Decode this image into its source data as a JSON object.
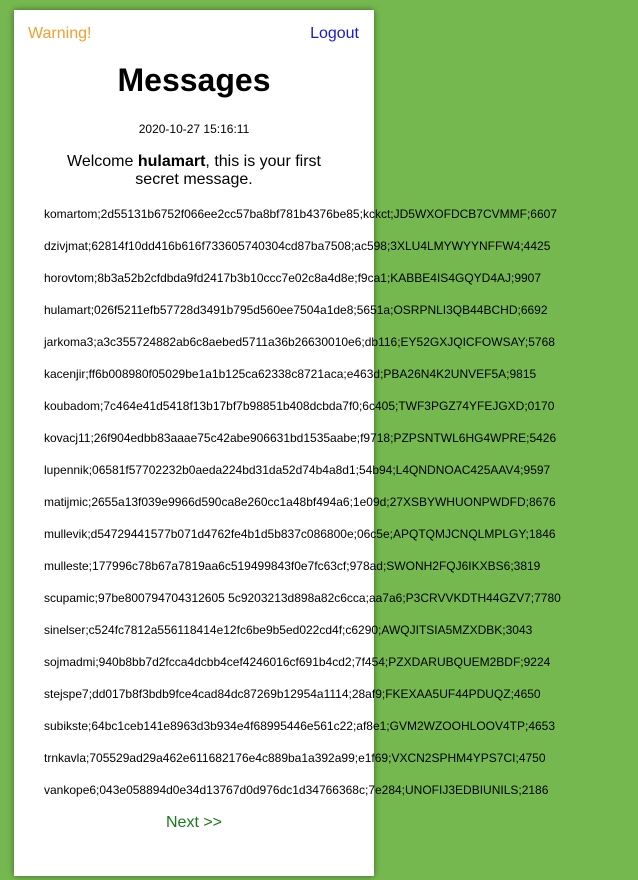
{
  "header": {
    "warning_label": "Warning!",
    "logout_label": "Logout"
  },
  "page": {
    "title": "Messages",
    "timestamp": "2020-10-27 15:16:11"
  },
  "welcome": {
    "prefix": "Welcome ",
    "username": "hulamart",
    "suffix": ", this is your first secret message."
  },
  "messages": [
    "komartom;2d55131b6752f066ee2cc57ba8bf781b4376be85;kckct;JD5WXOFDCB7CVMMF;6607",
    "dzivjmat;62814f10dd416b616f733605740304cd87ba7508;ac598;3XLU4LMYWYYNFFW4;4425",
    "horovtom;8b3a52b2cfdbda9fd2417b3b10ccc7e02c8a4d8e;f9ca1;KABBE4IS4GQYD4AJ;9907",
    "hulamart;026f5211efb57728d3491b795d560ee7504a1de8;5651a;OSRPNLI3QB44BCHD;6692",
    "jarkoma3;a3c355724882ab6c8aebed5711a36b26630010e6;db116;EY52GXJQICFOWSAY;5768",
    "kacenjir;ff6b008980f05029be1a1b125ca62338c8721aca;e463d;PBA26N4K2UNVEF5A;9815",
    "koubadom;7c464e41d5418f13b17bf7b98851b408dcbda7f0;6c405;TWF3PGZ74YFEJGXD;0170",
    "kovacj11;26f904edbb83aaae75c42abe906631bd1535aabe;f9718;PZPSNTWL6HG4WPRE;5426",
    "lupennik;06581f57702232b0aeda224bd31da52d74b4a8d1;54b94;L4QNDNOAC425AAV4;9597",
    "matijmic;2655a13f039e9966d590ca8e260cc1a48bf494a6;1e09d;27XSBYWHUONPWDFD;8676",
    "mullevik;d54729441577b071d4762fe4b1d5b837c086800e;06c5e;APQTQMJCNQLMPLGY;1846",
    "mulleste;177996c78b67a7819aa6c519499843f0e7fc63cf;978ad;SWONH2FQJ6IKXBS6;3819",
    "scupamic;97be800794704312605 5c9203213d898a82c6cca;aa7a6;P3CRVVKDTH44GZV7;7780",
    "sinelser;c524fc7812a556118414e12fc6be9b5ed022cd4f;c6290;AWQJITSIA5MZXDBK;3043",
    "sojmadmi;940b8bb7d2fcca4dcbb4cef4246016cf691b4cd2;7f454;PZXDARUBQUEM2BDF;9224",
    "stejspe7;dd017b8f3bdb9fce4cad84dc87269b12954a1114;28af9;FKEXAA5UF44PDUQZ;4650",
    "subikste;64bc1ceb141e8963d3b934e4f68995446e561c22;af8e1;GVM2WZOOHLOOV4TP;4653",
    "trnkavla;705529ad29a462e611682176e4c889ba1a392a99;e1f69;VXCN2SPHM4YPS7CI;4750",
    "vankope6;043e058894d0e34d13767d0d976dc1d34766368c;7e284;UNOFIJ3EDBIUNILS;2186"
  ],
  "footer": {
    "next_label": "Next >>"
  },
  "colors": {
    "background": "#75b84f",
    "warning": "#f0a030",
    "logout": "#1a1ad0",
    "next": "#1a7a1a"
  }
}
